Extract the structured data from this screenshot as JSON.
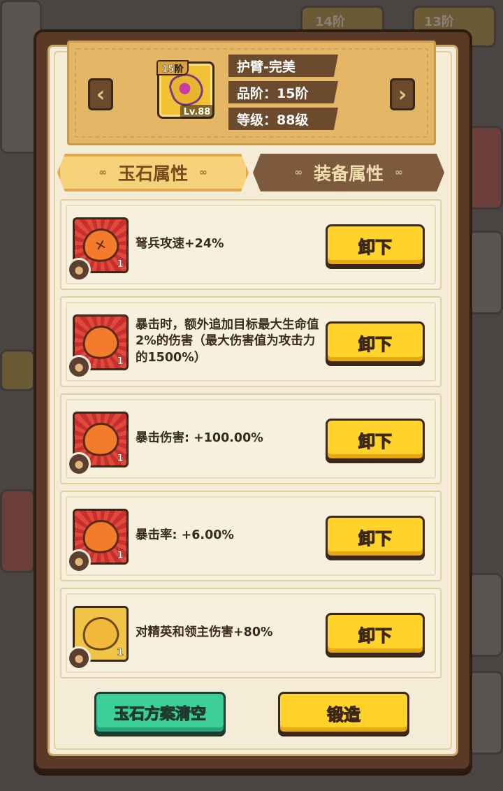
{
  "background": {
    "tier_tags": [
      "14阶",
      "13阶"
    ]
  },
  "item": {
    "tier_badge": "15阶",
    "level_badge": "Lv.88",
    "name": "护臂-完美",
    "quality": "品阶：15阶",
    "level": "等级：88级",
    "prev_arrow": "‹",
    "next_arrow": "›"
  },
  "tabs": [
    {
      "label": "玉石属性",
      "active": true
    },
    {
      "label": "装备属性",
      "active": false
    }
  ],
  "gems": [
    {
      "text": "弩兵攻速+24%",
      "count": "1",
      "color": "red",
      "glyph": "✕",
      "button": "卸下"
    },
    {
      "text": "暴击时，额外追加目标最大生命值2%的伤害（最大伤害值为攻击力的1500%）",
      "count": "1",
      "color": "red",
      "glyph": "",
      "button": "卸下"
    },
    {
      "text": "暴击伤害: +100.00%",
      "count": "1",
      "color": "red",
      "glyph": "",
      "button": "卸下"
    },
    {
      "text": "暴击率: +6.00%",
      "count": "1",
      "color": "red",
      "glyph": "",
      "button": "卸下"
    },
    {
      "text": "对精英和领主伤害+80%",
      "count": "1",
      "color": "gold",
      "glyph": "",
      "button": "卸下"
    }
  ],
  "footer": {
    "clear_label": "玉石方案清空",
    "forge_label": "锻造"
  },
  "colors": {
    "frame": "#5a3a26",
    "panel": "#f4ecd6",
    "yellow_button": "#ffd32a",
    "green_button": "#3ccf9a",
    "gem_red": "#d8382f",
    "gem_gold": "#f0c545"
  }
}
